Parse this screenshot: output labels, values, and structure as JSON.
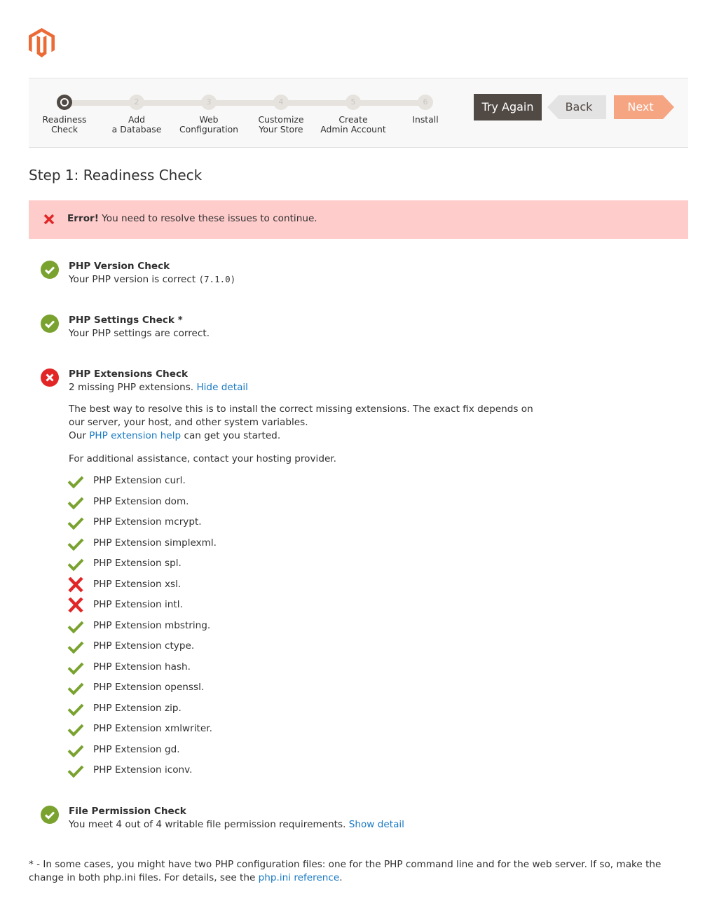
{
  "steps": [
    {
      "number": "",
      "label": "Readiness\nCheck",
      "active": true
    },
    {
      "number": "2",
      "label": "Add\na Database"
    },
    {
      "number": "3",
      "label": "Web\nConfiguration"
    },
    {
      "number": "4",
      "label": "Customize\nYour Store"
    },
    {
      "number": "5",
      "label": "Create\nAdmin Account"
    },
    {
      "number": "6",
      "label": "Install"
    }
  ],
  "buttons": {
    "try_again": "Try Again",
    "back": "Back",
    "next": "Next"
  },
  "page_title": "Step 1: Readiness Check",
  "error": {
    "strong": "Error!",
    "message": " You need to resolve these issues to continue."
  },
  "checks": {
    "php_version": {
      "title": "PHP Version Check",
      "desc": "Your PHP version is correct",
      "version": "(7.1.0)"
    },
    "php_settings": {
      "title": "PHP Settings Check *",
      "desc": "Your PHP settings are correct."
    },
    "php_extensions": {
      "title": "PHP Extensions Check",
      "desc": "2 missing PHP extensions.",
      "toggle_link": "Hide detail",
      "help_line1": "The best way to resolve this is to install the correct missing extensions. The exact fix depends on our server, your host, and other system variables.",
      "help_prefix": "Our ",
      "help_link": "PHP extension help",
      "help_suffix": " can get you started.",
      "assist": "For additional assistance, contact your hosting provider.",
      "items": [
        {
          "label": "PHP Extension curl.",
          "ok": true
        },
        {
          "label": "PHP Extension dom.",
          "ok": true
        },
        {
          "label": "PHP Extension mcrypt.",
          "ok": true
        },
        {
          "label": "PHP Extension simplexml.",
          "ok": true
        },
        {
          "label": "PHP Extension spl.",
          "ok": true
        },
        {
          "label": "PHP Extension xsl.",
          "ok": false
        },
        {
          "label": "PHP Extension intl.",
          "ok": false
        },
        {
          "label": "PHP Extension mbstring.",
          "ok": true
        },
        {
          "label": "PHP Extension ctype.",
          "ok": true
        },
        {
          "label": "PHP Extension hash.",
          "ok": true
        },
        {
          "label": "PHP Extension openssl.",
          "ok": true
        },
        {
          "label": "PHP Extension zip.",
          "ok": true
        },
        {
          "label": "PHP Extension xmlwriter.",
          "ok": true
        },
        {
          "label": "PHP Extension gd.",
          "ok": true
        },
        {
          "label": "PHP Extension iconv.",
          "ok": true
        }
      ]
    },
    "file_permission": {
      "title": "File Permission Check",
      "desc": "You meet 4 out of 4 writable file permission requirements.",
      "toggle_link": "Show detail"
    }
  },
  "footnote": {
    "text": "* - In some cases, you might have two PHP configuration files: one for the PHP command line and for the web server. If so, make the change in both php.ini files. For details, see the ",
    "link": "php.ini reference",
    "end": "."
  },
  "colors": {
    "success": "#79a22e",
    "error": "#e22626",
    "error_bg": "#ffcccc",
    "brand": "#ec6a36",
    "link": "#1979c3"
  }
}
